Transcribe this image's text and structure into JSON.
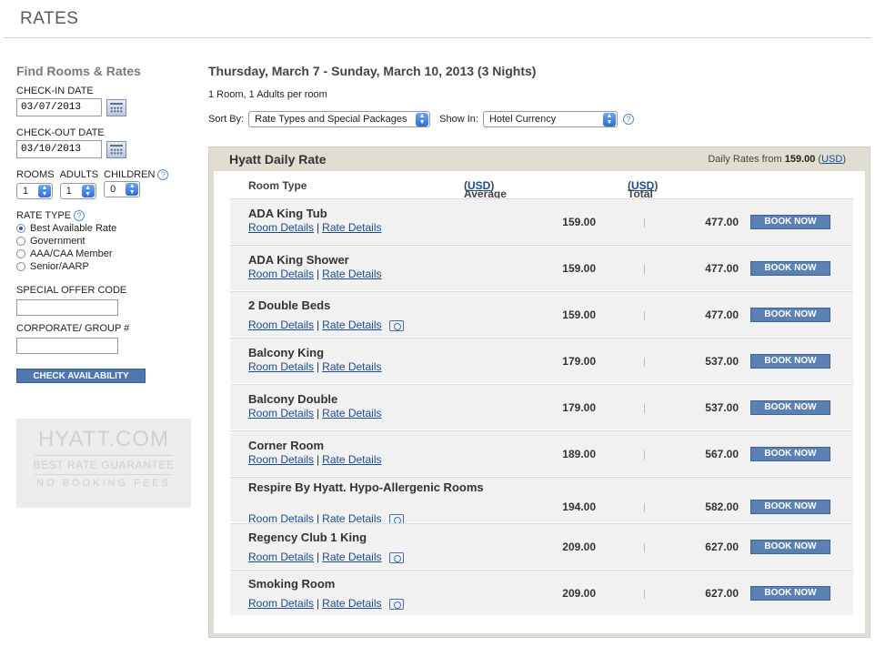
{
  "page": {
    "title": "RATES"
  },
  "sidebar": {
    "heading": "Find Rooms & Rates",
    "checkin_label": "CHECK-IN DATE",
    "checkin_value": "03/07/2013",
    "checkout_label": "CHECK-OUT DATE",
    "checkout_value": "03/10/2013",
    "rooms_label": "ROOMS",
    "rooms_value": "1",
    "adults_label": "ADULTS",
    "adults_value": "1",
    "children_label": "CHILDREN",
    "children_value": "0",
    "rate_type_label": "RATE TYPE",
    "rate_types": [
      {
        "label": "Best Available Rate",
        "selected": true
      },
      {
        "label": "Government",
        "selected": false
      },
      {
        "label": "AAA/CAA Member",
        "selected": false
      },
      {
        "label": "Senior/AARP",
        "selected": false
      }
    ],
    "offer_code_label": "SPECIAL OFFER CODE",
    "corporate_label": "CORPORATE/ GROUP #",
    "check_button": "CHECK AVAILABILITY",
    "help_glyph": "?"
  },
  "promo": {
    "line1": "HYATT.COM",
    "line2": "BEST RATE GUARANTEE",
    "line3": "NO BOOKING FEES"
  },
  "search": {
    "stay_dates": "Thursday, March 7 - Sunday, March 10, 2013 (3 Nights)",
    "occupancy": "1 Room, 1 Adults per room",
    "sort_label": "Sort By:",
    "sort_value": "Rate Types and Special Packages",
    "show_label": "Show In:",
    "show_value": "Hotel Currency"
  },
  "rate": {
    "name": "Hyatt Daily Rate",
    "from_label": "Daily Rates from",
    "from_value": "159.00",
    "currency": "USD",
    "col_room": "Room Type",
    "col_avg": "Average Daily Rate",
    "col_total": "Total Per Room",
    "details_link": "Room Details",
    "rate_link": "Rate Details",
    "book_label": "BOOK NOW",
    "rooms": [
      {
        "name": "ADA King Tub",
        "avg": "159.00",
        "total": "477.00",
        "camera": false
      },
      {
        "name": "ADA King Shower",
        "avg": "159.00",
        "total": "477.00",
        "camera": false
      },
      {
        "name": "2 Double Beds",
        "avg": "159.00",
        "total": "477.00",
        "camera": true
      },
      {
        "name": "Balcony King",
        "avg": "179.00",
        "total": "537.00",
        "camera": false
      },
      {
        "name": "Balcony Double",
        "avg": "179.00",
        "total": "537.00",
        "camera": false
      },
      {
        "name": "Corner Room",
        "avg": "189.00",
        "total": "567.00",
        "camera": false
      },
      {
        "name": "Respire By Hyatt. Hypo-Allergenic Rooms",
        "avg": "194.00",
        "total": "582.00",
        "camera": true
      },
      {
        "name": "Regency Club 1 King",
        "avg": "209.00",
        "total": "627.00",
        "camera": true
      },
      {
        "name": "Smoking Room",
        "avg": "209.00",
        "total": "627.00",
        "camera": true
      }
    ]
  }
}
